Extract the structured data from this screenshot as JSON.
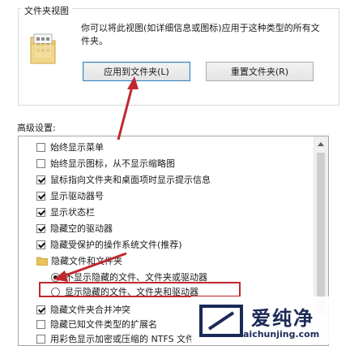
{
  "group": {
    "title": "文件夹视图",
    "description": "你可以将此视图(如详细信息或图标)应用于这种类型的所有文件夹。",
    "apply_button": "应用到文件夹(L)",
    "reset_button": "重置文件夹(R)"
  },
  "advanced": {
    "label": "高级设置:",
    "items": [
      {
        "type": "checkbox",
        "checked": false,
        "label": "始终显示菜单"
      },
      {
        "type": "checkbox",
        "checked": false,
        "label": "始终显示图标，从不显示缩略图"
      },
      {
        "type": "checkbox",
        "checked": true,
        "label": "鼠标指向文件夹和桌面项时显示提示信息"
      },
      {
        "type": "checkbox",
        "checked": true,
        "label": "显示驱动器号"
      },
      {
        "type": "checkbox",
        "checked": true,
        "label": "显示状态栏"
      },
      {
        "type": "checkbox",
        "checked": true,
        "label": "隐藏空的驱动器"
      },
      {
        "type": "checkbox",
        "checked": true,
        "label": "隐藏受保护的操作系统文件(推荐)"
      },
      {
        "type": "folder",
        "label": "隐藏文件和文件夹"
      },
      {
        "type": "radio",
        "checked": true,
        "label": "不显示隐藏的文件、文件夹或驱动器"
      },
      {
        "type": "radio",
        "checked": false,
        "label": "显示隐藏的文件、文件夹和驱动器"
      },
      {
        "type": "checkbox",
        "checked": true,
        "label": "隐藏文件夹合并冲突"
      },
      {
        "type": "checkbox",
        "checked": false,
        "label": "隐藏已知文件类型的扩展名"
      },
      {
        "type": "checkbox",
        "checked": false,
        "label": "用彩色显示加密或压缩的 NTFS 文件"
      }
    ]
  },
  "watermark": {
    "text": "爱纯净",
    "url": "aichunjing.com"
  },
  "colors": {
    "annotation_red": "#c0282e",
    "watermark_navy": "#1a2a57"
  }
}
